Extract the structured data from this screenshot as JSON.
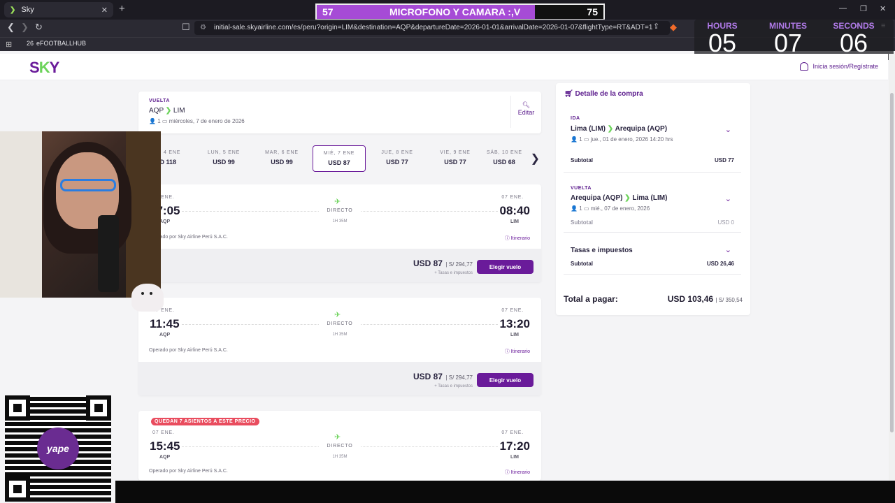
{
  "browser": {
    "tab_title": "Sky",
    "tab_favicon": "❯",
    "url": "initial-sale.skyairline.com/es/peru?origin=LIM&destination=AQP&departureDate=2026-01-01&arrivalDate=2026-01-07&flightType=RT&ADT=1",
    "bookmark": "eFOOTBALLHUB",
    "bookmark_icon": "26"
  },
  "stream_overlay": {
    "mic_left": "57",
    "mic_label": "MICROFONO Y CAMARA :,V",
    "mic_right": "75",
    "mic_progress": 0.76,
    "countdown": {
      "hours_label": "HOURS",
      "minutes_label": "MINUTES",
      "seconds_label": "SECONDS",
      "hours": "05",
      "minutes": "07",
      "seconds": "06"
    },
    "qr_brand": "yape"
  },
  "site": {
    "logo_s": "S",
    "logo_k": "K",
    "logo_y": "Y",
    "login": "Inicia sesión/Regístrate"
  },
  "search": {
    "tag": "VUELTA",
    "origin": "AQP",
    "destination": "LIM",
    "passengers": "1",
    "date": "miércoles, 7 de enero de 2026",
    "edit": "Editar"
  },
  "dates": [
    {
      "day": "DOM, 4 ENE",
      "price": "USD 118"
    },
    {
      "day": "LUN, 5 ENE",
      "price": "USD 99"
    },
    {
      "day": "MAR, 6 ENE",
      "price": "USD 99"
    },
    {
      "day": "MIÉ, 7 ENE",
      "price": "USD 87"
    },
    {
      "day": "JUE, 8 ENE",
      "price": "USD 77"
    },
    {
      "day": "VIE, 9 ENE",
      "price": "USD 77"
    },
    {
      "day": "SÁB, 10 ENE",
      "price": "USD 68"
    }
  ],
  "flights": [
    {
      "badge": "",
      "dep_date": "07 ENE.",
      "dep_time": "07:05",
      "dep_ap": "AQP",
      "arr_date": "07 ENE.",
      "arr_time": "08:40",
      "arr_ap": "LIM",
      "direct": "DIRECTO",
      "duration": "1H 35M",
      "operator": "Operado por Sky Airline Perú S.A.C.",
      "itinerary": "Itinerario",
      "price_usd": "USD 87",
      "price_pen": "| S/ 294,77",
      "taxes": "+ Tasas e impuestos",
      "choose": "Elegir vuelo"
    },
    {
      "badge": "",
      "dep_date": "07 ENE.",
      "dep_time": "11:45",
      "dep_ap": "AQP",
      "arr_date": "07 ENE.",
      "arr_time": "13:20",
      "arr_ap": "LIM",
      "direct": "DIRECTO",
      "duration": "1H 35M",
      "operator": "Operado por Sky Airline Perú S.A.C.",
      "itinerary": "Itinerario",
      "price_usd": "USD 87",
      "price_pen": "| S/ 294,77",
      "taxes": "+ Tasas e impuestos",
      "choose": "Elegir vuelo"
    },
    {
      "badge": "QUEDAN 7 ASIENTOS A ESTE PRECIO",
      "dep_date": "07 ENE.",
      "dep_time": "15:45",
      "dep_ap": "AQP",
      "arr_date": "07 ENE.",
      "arr_time": "17:20",
      "arr_ap": "LIM",
      "direct": "DIRECTO",
      "duration": "1H 35M",
      "operator": "Operado por Sky Airline Perú S.A.C.",
      "itinerary": "Itinerario"
    }
  ],
  "detail": {
    "title": "Detalle de la compra",
    "outbound": {
      "tag": "IDA",
      "from": "Lima (LIM)",
      "to": "Arequipa (AQP)",
      "passengers": "1",
      "date": "jue., 01 de enero, 2026 14:20 hrs",
      "subtotal_label": "Subtotal",
      "subtotal": "USD 77"
    },
    "return": {
      "tag": "VUELTA",
      "from": "Arequipa (AQP)",
      "to": "Lima (LIM)",
      "passengers": "1",
      "date": "mié., 07 de enero, 2026",
      "subtotal_label": "Subtotal",
      "subtotal": "USD 0"
    },
    "taxes": {
      "title": "Tasas e impuestos",
      "subtotal_label": "Subtotal",
      "subtotal": "USD 26,46"
    },
    "total_label": "Total a pagar:",
    "total_usd": "USD 103,46",
    "total_pen": "| S/ 350,54"
  },
  "colors": {
    "brand_purple": "#6a1b9a",
    "brand_green": "#6cd35a",
    "badge_red": "#e94c5e"
  }
}
